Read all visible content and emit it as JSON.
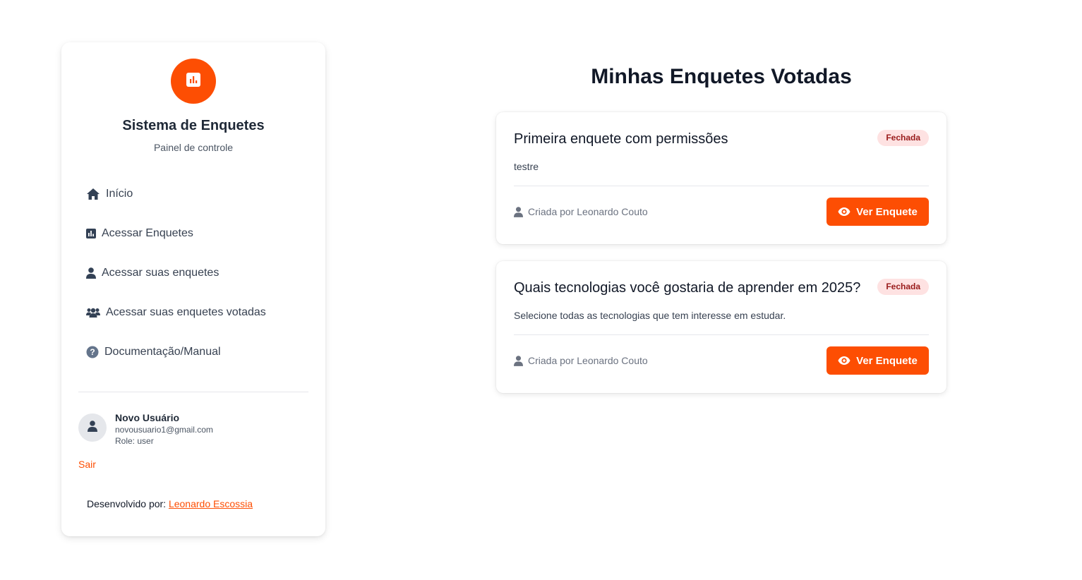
{
  "colors": {
    "accent": "#fd4e03",
    "badge_bg": "#fee2e2",
    "badge_text": "#991b1b"
  },
  "sidebar": {
    "logo_icon": "bar-chart-icon",
    "title": "Sistema de Enquetes",
    "subtitle": "Painel de controle",
    "nav": [
      {
        "label": "Início",
        "icon": "home-icon"
      },
      {
        "label": "Acessar Enquetes",
        "icon": "bar-chart-icon"
      },
      {
        "label": "Acessar suas enquetes",
        "icon": "user-icon"
      },
      {
        "label": "Acessar suas enquetes votadas",
        "icon": "users-icon"
      },
      {
        "label": "Documentação/Manual",
        "icon": "question-circle-icon"
      }
    ],
    "user": {
      "name": "Novo Usuário",
      "email": "novousuario1@gmail.com",
      "role": "Role: user"
    },
    "logout_label": "Sair",
    "credits_prefix": "Desenvolvido por:",
    "credits_link": "Leonardo Escossia"
  },
  "main": {
    "title": "Minhas Enquetes Votadas",
    "polls": [
      {
        "title": "Primeira enquete com permissões",
        "status": "Fechada",
        "description": "testre",
        "creator": "Criada por Leonardo Couto",
        "button_label": "Ver Enquete"
      },
      {
        "title": "Quais tecnologias você gostaria de aprender em 2025?",
        "status": "Fechada",
        "description": "Selecione todas as tecnologias que tem interesse em estudar.",
        "creator": "Criada por Leonardo Couto",
        "button_label": "Ver Enquete"
      }
    ]
  }
}
